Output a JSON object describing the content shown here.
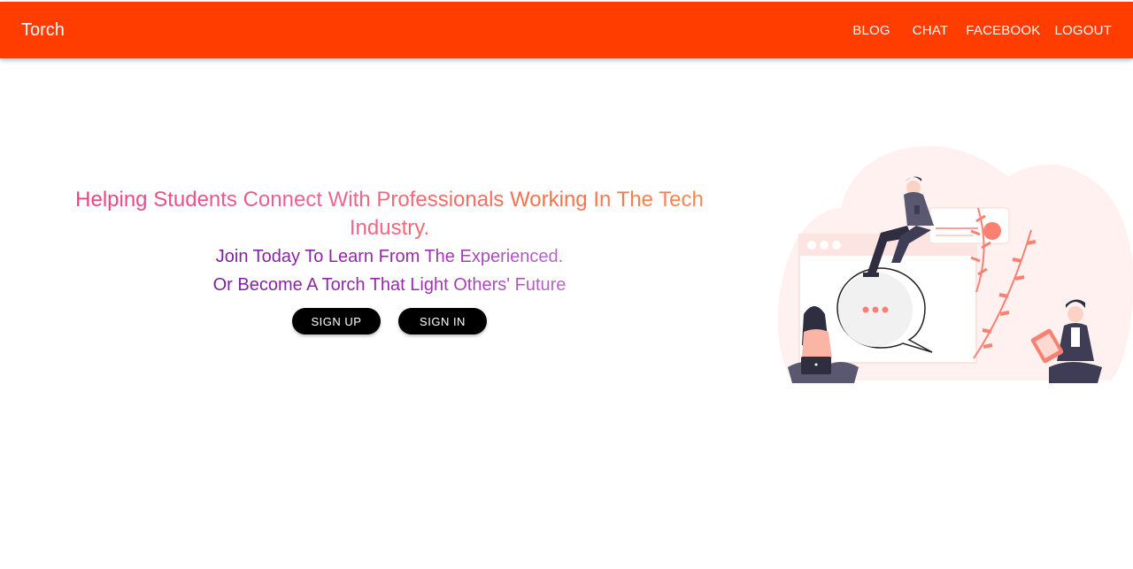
{
  "header": {
    "brand": "Torch",
    "nav": [
      "BLOG",
      "CHAT",
      "FACEBOOK",
      "LOGOUT"
    ]
  },
  "hero": {
    "headline": "Helping Students Connect With Professionals Working In The Tech Industry.",
    "line1": "Join Today To Learn From The Experienced.",
    "line2": "Or Become A Torch That Light Others' Future",
    "signup_label": "SIGN UP",
    "signin_label": "SIGN IN"
  },
  "colors": {
    "header_bg": "#ff3d00",
    "button_bg": "#000000",
    "illustration_accent": "#fa8072"
  },
  "illustration": {
    "icon": "people-chatting-illustration"
  }
}
